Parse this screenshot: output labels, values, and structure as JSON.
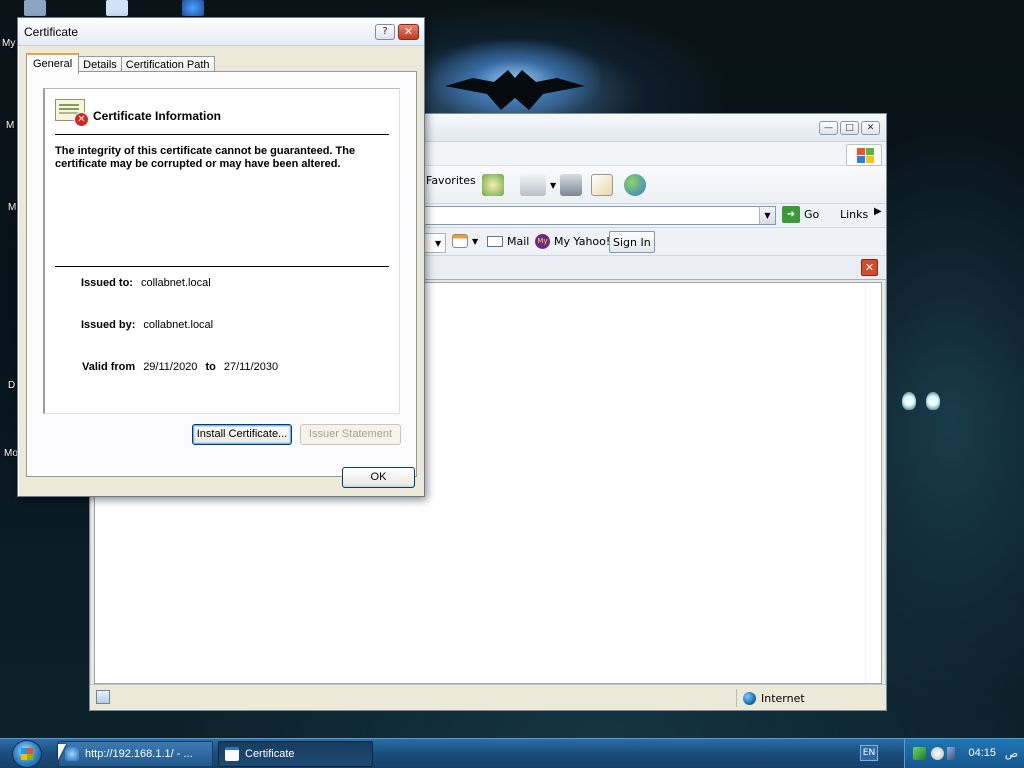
{
  "desktop": {
    "icon_labels": [
      "My",
      "M",
      "M",
      "D",
      "Mo"
    ]
  },
  "ie_window": {
    "toolbar": {
      "favorites_label": "Favorites"
    },
    "addressbar": {
      "go_label": "Go",
      "links_label": "Links"
    },
    "yahoo_toolbar": {
      "mail_label": "Mail",
      "my_yahoo_label": "My Yahoo!",
      "signin_label": "Sign In"
    },
    "status": {
      "zone_label": "Internet"
    }
  },
  "certificate_dialog": {
    "title": "Certificate",
    "tabs": [
      "General",
      "Details",
      "Certification Path"
    ],
    "active_tab": "General",
    "heading": "Certificate Information",
    "warning": "The integrity of this certificate cannot be guaranteed. The certificate may be corrupted or may have been altered.",
    "issued_to_label": "Issued to:",
    "issued_to_value": "collabnet.local",
    "issued_by_label": "Issued by:",
    "issued_by_value": "collabnet.local",
    "valid_from_label": "Valid from",
    "valid_from_value": "29/11/2020",
    "valid_to_label": "to",
    "valid_to_value": "27/11/2030",
    "install_button": "Install Certificate...",
    "issuer_button": "Issuer Statement",
    "ok_button": "OK"
  },
  "taskbar": {
    "tasks": [
      {
        "label": "http://192.168.1.1/ - ..."
      },
      {
        "label": "Certificate"
      }
    ],
    "lang": "EN",
    "clock": "04:15",
    "ampm": "ص"
  }
}
